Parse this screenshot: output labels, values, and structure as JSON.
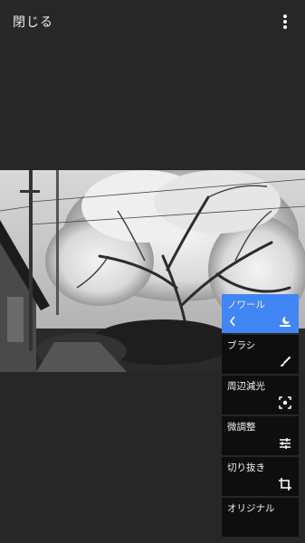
{
  "header": {
    "close_label": "閉じる",
    "more_icon": "more-vert-icon"
  },
  "menu": {
    "items": [
      {
        "label": "ノワール",
        "icon": "noir-icon",
        "active": true
      },
      {
        "label": "ブラシ",
        "icon": "brush-icon",
        "active": false
      },
      {
        "label": "周辺減光",
        "icon": "vignette-icon",
        "active": false
      },
      {
        "label": "微調整",
        "icon": "tune-icon",
        "active": false
      },
      {
        "label": "切り抜き",
        "icon": "crop-icon",
        "active": false
      },
      {
        "label": "オリジナル",
        "icon": "",
        "active": false
      }
    ]
  },
  "colors": {
    "background": "#272727",
    "accent": "#4285f4",
    "menu_bg": "#0e0e0e"
  }
}
